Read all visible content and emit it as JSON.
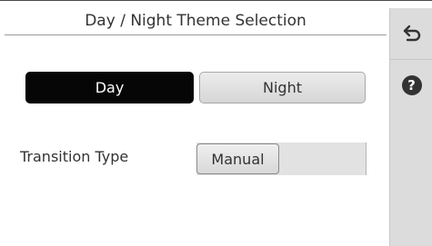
{
  "header": {
    "title": "Day / Night Theme Selection"
  },
  "sidebar": {
    "back_icon": "back-arrow-icon",
    "help_icon": "help-icon",
    "help_glyph": "?"
  },
  "theme": {
    "options": [
      {
        "label": "Day",
        "selected": true
      },
      {
        "label": "Night",
        "selected": false
      }
    ]
  },
  "transition": {
    "label": "Transition Type",
    "value": "Manual"
  },
  "colors": {
    "selected_button": "#060606",
    "unselected_button": "#e0e0e0",
    "sidebar": "#dcdcdc"
  }
}
